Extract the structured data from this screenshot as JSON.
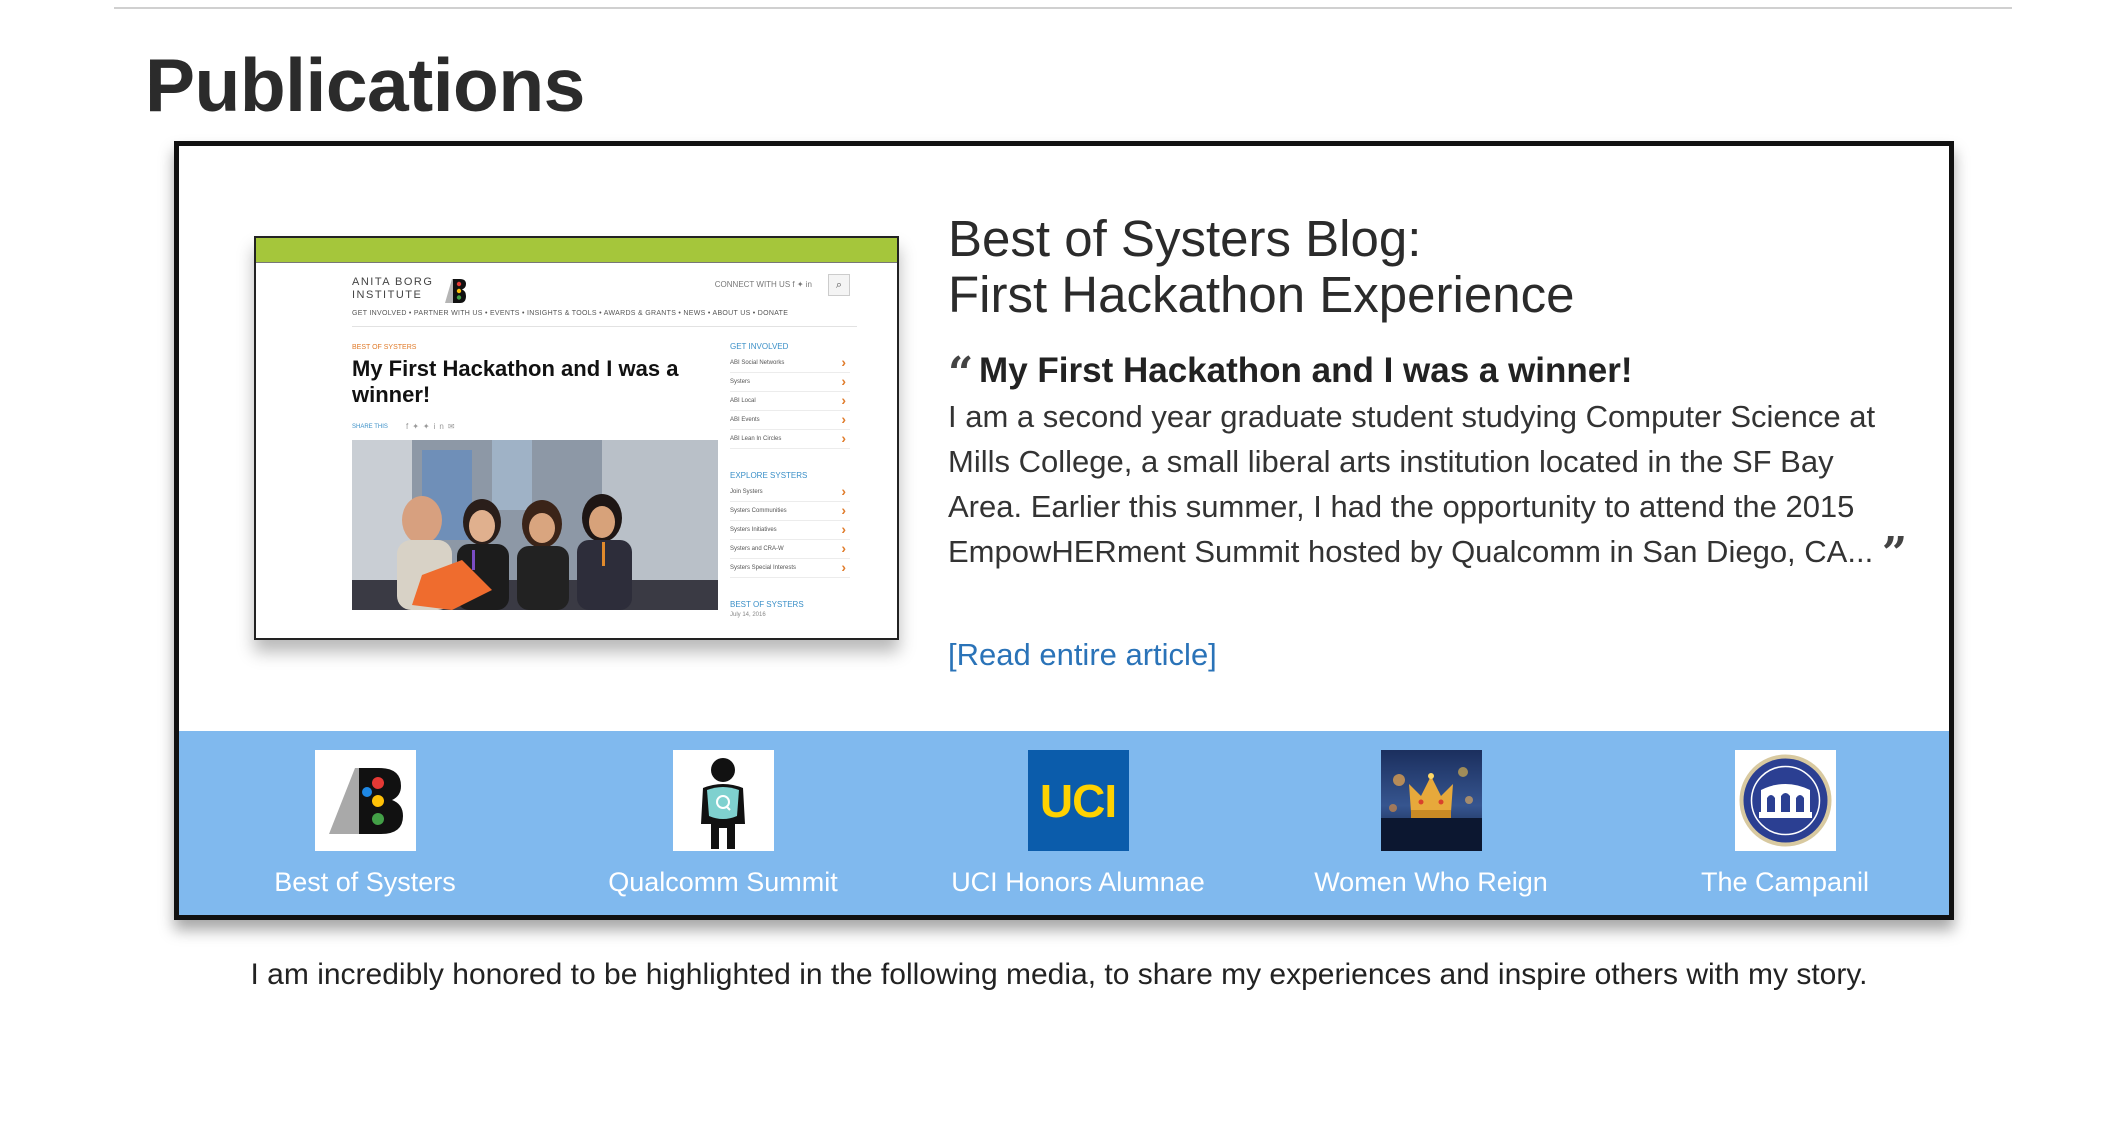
{
  "page": {
    "title": "Publications",
    "caption": "I am incredibly honored to be highlighted in the following media, to share my experiences and inspire others with my story."
  },
  "feature": {
    "title_line1": "Best of Systers Blog:",
    "title_line2": "First Hackathon Experience",
    "quote_headline": "My First Hackathon and I was a winner!",
    "quote_body": "I am a second year graduate student studying Computer Science at Mills College, a small liberal arts institution located in the SF Bay Area. Earlier this summer, I had the opportunity to attend the 2015 EmpowHERment Summit hosted by Qualcomm in San Diego, CA...",
    "read_more": "[Read entire article]",
    "screenshot": {
      "logo_text": "ANITA BORG\nINSTITUTE",
      "connect": "CONNECT WITH US   f   ✦   in",
      "nav": "GET INVOLVED  •  PARTNER WITH US  •  EVENTS  •  INSIGHTS & TOOLS  •  AWARDS & GRANTS  •  NEWS  •  ABOUT US  •  DONATE",
      "kicker": "BEST OF SYSTERS",
      "headline": "My First Hackathon and I was a winner!",
      "share": "SHARE THIS",
      "sidebar": [
        {
          "heading": "GET INVOLVED",
          "items": [
            "ABI Social Networks",
            "Systers",
            "ABI Local",
            "ABI Events",
            "ABI Lean In Circles"
          ]
        },
        {
          "heading": "EXPLORE SYSTERS",
          "items": [
            "Join Systers",
            "Systers Communities",
            "Systers Initiatives",
            "Systers and CRA-W",
            "Systers Special Interests"
          ]
        },
        {
          "heading": "BEST OF SYSTERS",
          "items": []
        }
      ],
      "sidebar_date": "July 14, 2016"
    }
  },
  "publications": [
    {
      "label": "Best of Systers",
      "icon": "abi-logo"
    },
    {
      "label": "Qualcomm Summit",
      "icon": "qualcomm-figure"
    },
    {
      "label": "UCI Honors Alumnae",
      "icon": "uci-logo",
      "logo_text": "UCI"
    },
    {
      "label": "Women Who Reign",
      "icon": "crown-photo"
    },
    {
      "label": "The Campanil",
      "icon": "campanil-seal"
    }
  ],
  "colors": {
    "strip": "#80b9ee",
    "link": "#2a73b8",
    "uci_blue": "#0b5cab",
    "uci_gold": "#ffd200",
    "abi_green": "#a5c63b"
  }
}
